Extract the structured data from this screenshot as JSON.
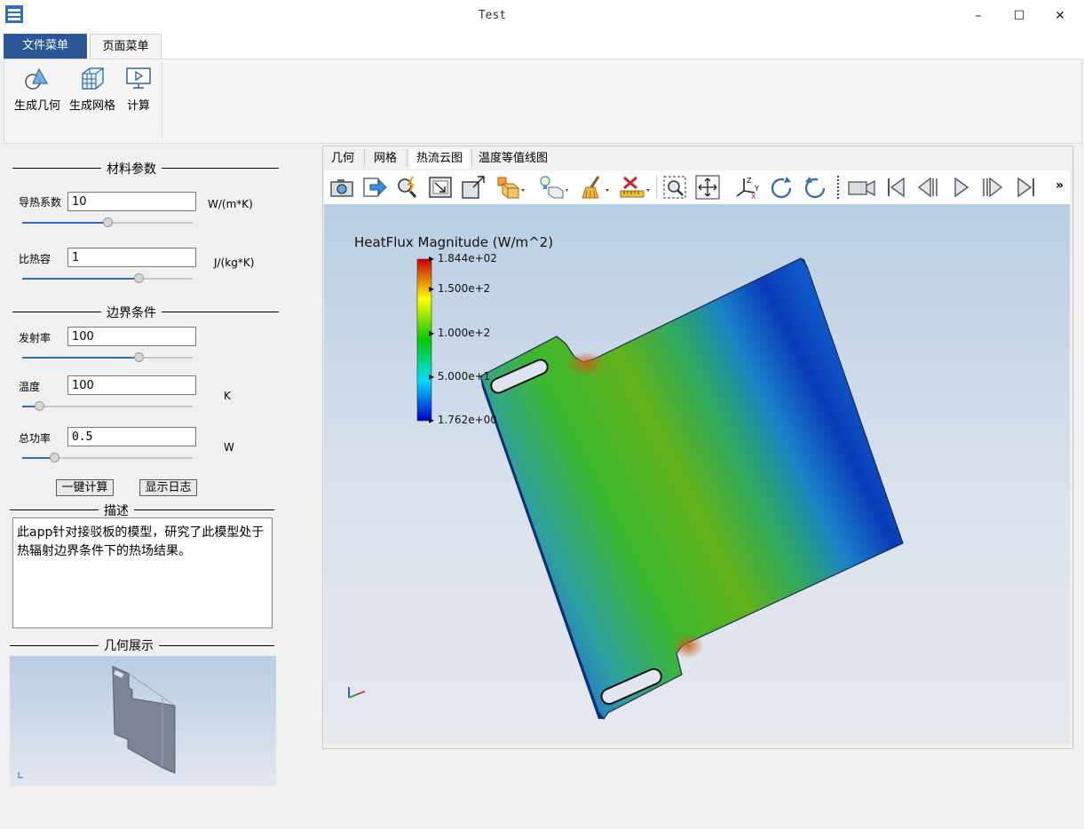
{
  "window": {
    "title": "Test",
    "minimize": "–",
    "maximize": "☐",
    "close": "✕"
  },
  "ribbon": {
    "tabs": [
      "文件菜单",
      "页面菜单"
    ],
    "buttons": [
      {
        "label": "生成几何",
        "icon": "geometry-icon"
      },
      {
        "label": "生成网格",
        "icon": "mesh-icon"
      },
      {
        "label": "计算",
        "icon": "compute-icon"
      }
    ]
  },
  "left_panel": {
    "material": {
      "title": "材料参数",
      "conductivity": {
        "label": "导热系数",
        "value": "10",
        "unit": "W/(m*K)",
        "slider": 0.5
      },
      "heat_capacity": {
        "label": "比热容",
        "value": "1",
        "unit": "J/(kg*K)",
        "slider": 0.68
      }
    },
    "boundary": {
      "title": "边界条件",
      "emissivity": {
        "label": "发射率",
        "value": "100",
        "unit": "",
        "slider": 0.68
      },
      "temperature": {
        "label": "温度",
        "value": "100",
        "unit": "K",
        "slider": 0.1
      },
      "power": {
        "label": "总功率",
        "value": "0.5",
        "unit": "W",
        "slider": 0.19
      }
    },
    "buttons": {
      "compute": "一键计算",
      "log": "显示日志"
    },
    "description": {
      "title": "描述",
      "text": "此app针对接驳板的模型，研究了此模型处于热辐射边界条件下的热场结果。"
    },
    "geometry": {
      "title": "几何展示"
    }
  },
  "view_tabs": [
    "几何",
    "网格",
    "热流云图",
    "温度等值线图"
  ],
  "active_view_tab": 2,
  "toolbar": {
    "icons": [
      "camera-icon",
      "export-icon",
      "probe-icon",
      "zoom-fit-icon",
      "zoom-box-icon",
      "cube-view-icon",
      "light-icon",
      "clear-icon",
      "ruler-icon",
      "zoom-region-icon",
      "pan-icon",
      "axes-icon",
      "rotate-cw-icon",
      "rotate-ccw-icon",
      "video-camera-icon",
      "first-frame-icon",
      "previous-frame-icon",
      "play-icon",
      "next-frame-icon",
      "last-frame-icon"
    ],
    "more": "»"
  },
  "legend": {
    "title": "HeatFlux Magnitude (W/m^2)",
    "ticks": [
      "1.844e+02",
      "1.500e+2",
      "1.000e+2",
      "5.000e+1",
      "1.762e+00"
    ],
    "colors": [
      "#cc0000",
      "#ffff00",
      "#00c800",
      "#00e0ff",
      "#0000cc"
    ]
  }
}
